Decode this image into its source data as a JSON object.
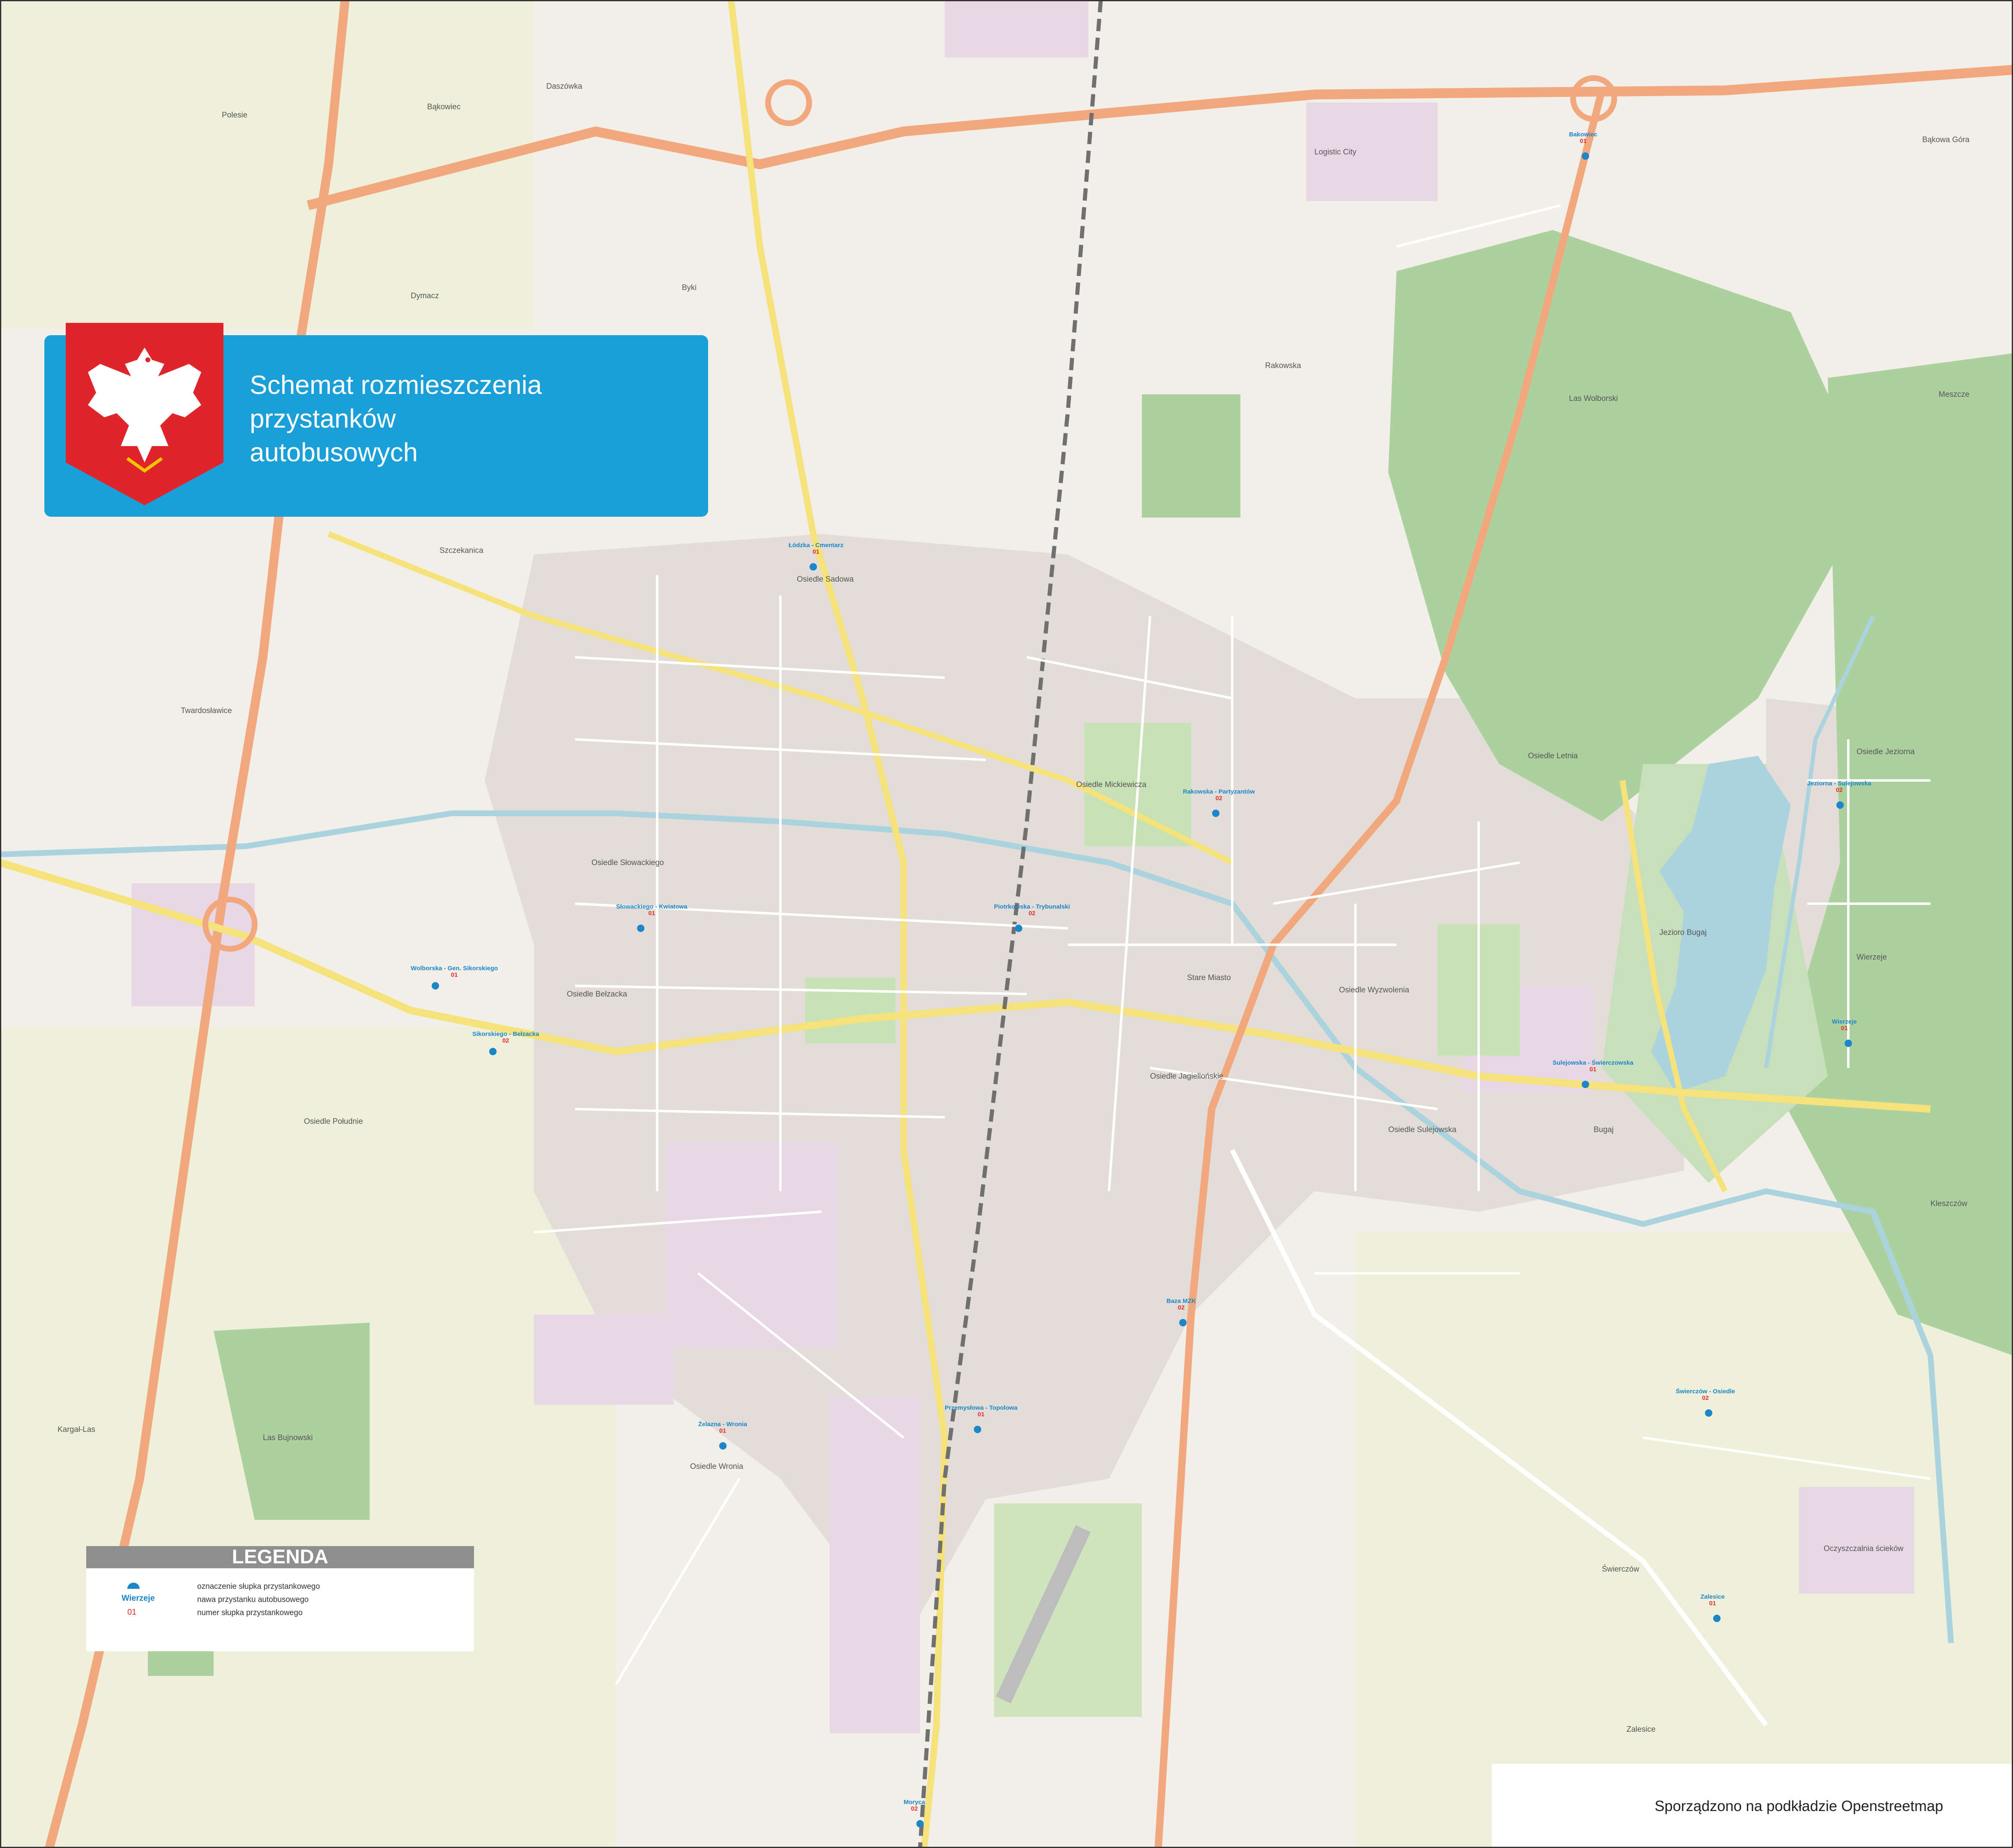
{
  "title": {
    "lines": [
      "Schemat rozmieszczenia",
      "przystanków",
      "autobusowych"
    ]
  },
  "colors": {
    "title_panel": "#1b9fd8",
    "crest_red": "#e0242b",
    "stop_name": "#1b86c9",
    "stop_number": "#e32d2d",
    "trunk_road": "#f2a77c",
    "secondary_road": "#f6e27a",
    "forest": "#add19e",
    "water": "#aad3df",
    "rail": "#707070"
  },
  "legend": {
    "heading": "LEGENDA",
    "rows": [
      {
        "label": "oznaczenie słupka przystankowego",
        "icon": "stop-pole-icon"
      },
      {
        "label": "nawa przystanku autobusowego",
        "sample": "Wierzeje"
      },
      {
        "label": "numer słupka przystankowego",
        "sample": "01"
      }
    ]
  },
  "source_note": "Sporządzono na podkładzie Openstreetmap",
  "places": [
    "Daszówka",
    "Bąkowiec",
    "Polesie",
    "Byki",
    "Dymacz",
    "Szczekanica",
    "Twardosławice",
    "Kargał-Las",
    "Las Bujnowski",
    "Osiedle Bełzacka",
    "Osiedle Południe",
    "Osiedle Słowackiego",
    "Osiedle Sadowa",
    "Osiedle Mickiewicza",
    "Stare Miasto",
    "Osiedle Jagiellońskie",
    "Osiedle Sulejowska",
    "Osiedle Wyzwolenia",
    "Osiedle Wronia",
    "Osiedle Letnia",
    "Osiedle Jeziorna",
    "Wierzeje",
    "Las Wolborski",
    "Logistic City",
    "Jezioro Bugaj",
    "Zalesice",
    "Świerczów",
    "Bugaj",
    "Meszcze",
    "Bąkowa Góra",
    "Oczyszczalnia ścieków",
    "Kleszczów",
    "Rakowska"
  ],
  "stops": [
    {
      "name": "Wolborska - Gen. Sikorskiego",
      "num": "01"
    },
    {
      "name": "Sikorskiego - Bełzacka",
      "num": "02"
    },
    {
      "name": "Słowackiego - Kwiatowa",
      "num": "01"
    },
    {
      "name": "Piotrkowska - Trybunalski",
      "num": "02"
    },
    {
      "name": "Sulejowska - Świerczowska",
      "num": "01"
    },
    {
      "name": "Wierzeje",
      "num": "01"
    },
    {
      "name": "Jeziorna - Sulejowska",
      "num": "02"
    },
    {
      "name": "Łódzka - Cmentarz",
      "num": "01"
    },
    {
      "name": "Rakowska - Partyzantów",
      "num": "02"
    },
    {
      "name": "Żelazna - Wronia",
      "num": "01"
    },
    {
      "name": "Baza MZK",
      "num": "02"
    },
    {
      "name": "Zalesice",
      "num": "01"
    },
    {
      "name": "Bakowiec",
      "num": "01"
    },
    {
      "name": "Świerczów - Osiedle",
      "num": "02"
    },
    {
      "name": "Przemysłowa - Topolowa",
      "num": "01"
    },
    {
      "name": "Moryca",
      "num": "02"
    }
  ]
}
